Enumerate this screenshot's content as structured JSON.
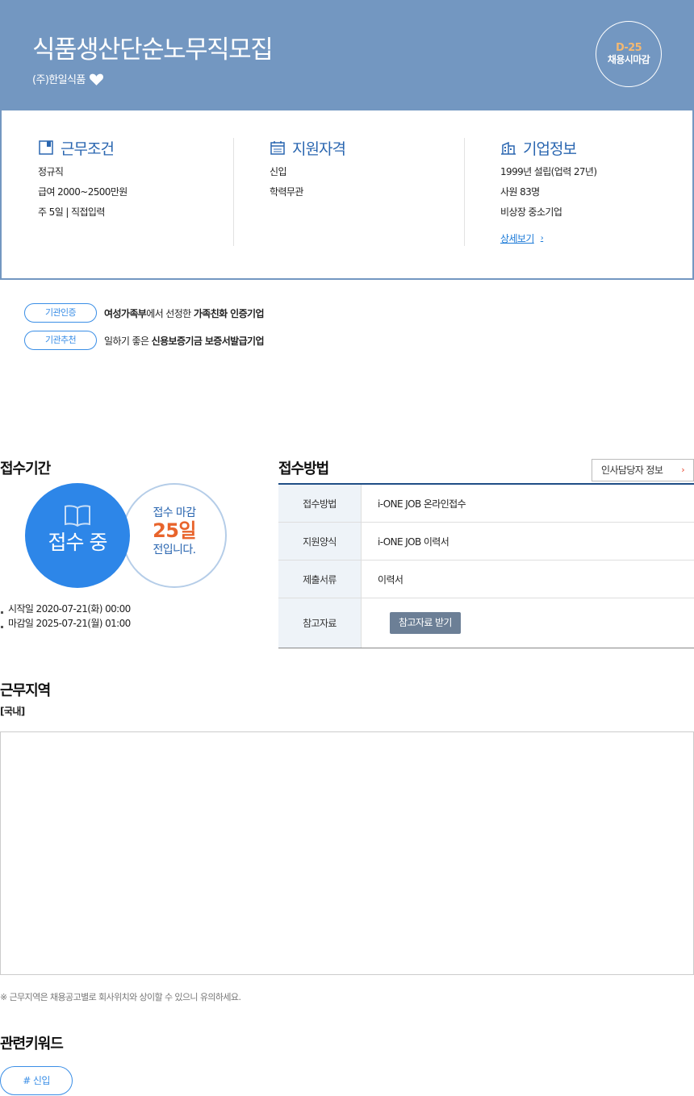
{
  "header": {
    "title": "식품생산단순노무직모집",
    "company": "(주)한일식품",
    "dday": "D-25",
    "dday_text": "채용시마감"
  },
  "summary": {
    "conditions": {
      "title": "근무조건",
      "lines": [
        "정규직",
        "급여 2000~2500만원",
        "주 5일 | 직접입력"
      ]
    },
    "qualifications": {
      "title": "지원자격",
      "lines": [
        "신입",
        "학력무관"
      ]
    },
    "company_info": {
      "title": "기업정보",
      "lines": [
        "1999년 설립(업력 27년)",
        "사원 83명",
        "비상장 중소기업"
      ],
      "more": "상세보기"
    }
  },
  "certifications": [
    {
      "tag": "기관인증",
      "pre": "",
      "bold1": "여성가족부",
      "mid": "에서 선정한 ",
      "bold2": "가족친화 인증기업"
    },
    {
      "tag": "기관추천",
      "pre": "일하기 좋은 ",
      "bold1": "",
      "mid": "",
      "bold2": "신용보증기금 보증서발급기업"
    }
  ],
  "reception_period": {
    "title": "접수기간",
    "status": "접수 중",
    "deadline_label": "접수 마감",
    "days_left": "25일",
    "days_suffix": "전입니다.",
    "start": "시작일 2020-07-21(화) 00:00",
    "end": "마감일 2025-07-21(월) 01:00"
  },
  "application_method": {
    "title": "접수방법",
    "hr_button": "인사담당자 정보",
    "rows": [
      {
        "label": "접수방법",
        "value": "i-ONE JOB 온라인접수"
      },
      {
        "label": "지원양식",
        "value": "i-ONE JOB 이력서"
      },
      {
        "label": "제출서류",
        "value": "이력서"
      },
      {
        "label": "참고자료",
        "value": "참고자료 받기"
      }
    ]
  },
  "work_region": {
    "title": "근무지역",
    "sub": "[국내]",
    "note": "※ 근무지역은 채용공고별로 회사위치와 상이할 수 있으니 유의하세요."
  },
  "keywords": {
    "title": "관련키워드",
    "items": [
      "# 신입"
    ]
  }
}
